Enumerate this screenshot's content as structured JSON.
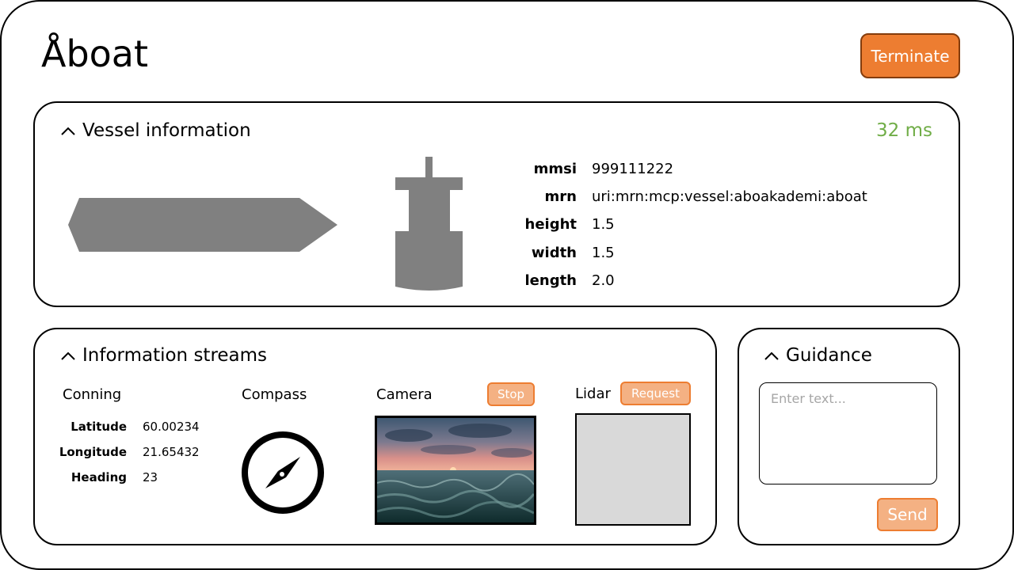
{
  "app": {
    "title": "Åboat",
    "terminate_label": "Terminate"
  },
  "vessel_panel": {
    "title": "Vessel information",
    "latency": "32 ms",
    "fields": [
      {
        "label": "mmsi",
        "value": "999111222"
      },
      {
        "label": "mrn",
        "value": "uri:mrn:mcp:vessel:aboakademi:aboat"
      },
      {
        "label": "height",
        "value": "1.5"
      },
      {
        "label": "width",
        "value": "1.5"
      },
      {
        "label": "length",
        "value": "2.0"
      }
    ]
  },
  "streams_panel": {
    "title": "Information streams",
    "conning": {
      "title": "Conning",
      "rows": [
        {
          "label": "Latitude",
          "value": "60.00234"
        },
        {
          "label": "Longitude",
          "value": "21.65432"
        },
        {
          "label": "Heading",
          "value": "23"
        }
      ]
    },
    "compass": {
      "title": "Compass",
      "icon": "compass-icon"
    },
    "camera": {
      "title": "Camera",
      "stop_label": "Stop"
    },
    "lidar": {
      "title": "Lidar",
      "request_label": "Request"
    }
  },
  "guidance_panel": {
    "title": "Guidance",
    "input_placeholder": "Enter text...",
    "input_value": "",
    "send_label": "Send"
  },
  "colors": {
    "accent": "#ed7d31",
    "accent_light": "#f4b183",
    "latency_green": "#70ad47",
    "silhouette_gray": "#808080"
  }
}
